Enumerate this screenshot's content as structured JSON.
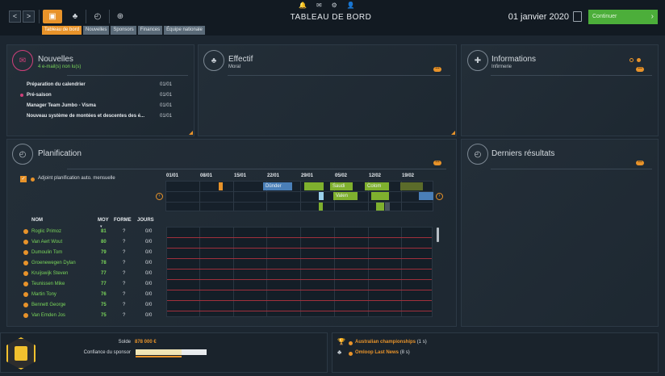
{
  "topbar": {
    "title": "TABLEAU DE BORD",
    "date": "01 janvier 2020",
    "continue_label": "Continuer",
    "nav_back": "<",
    "nav_forward": ">",
    "top_icons": [
      "bell-icon",
      "mail-icon",
      "gear-icon",
      "user-icon"
    ]
  },
  "tabs": [
    "Tableau de bord",
    "Nouvelles",
    "Sponsors",
    "Finances",
    "Équipe nationale"
  ],
  "panels": {
    "news": {
      "title": "Nouvelles",
      "subtitle": "4 e-mail(s) non lu(s)",
      "items": [
        {
          "subject": "Préparation du calendrier",
          "date": "01/01",
          "flag": false
        },
        {
          "subject": "Pré-saison",
          "date": "01/01",
          "flag": true
        },
        {
          "subject": "Manager Team Jumbo - Visma",
          "date": "01/01",
          "flag": false
        },
        {
          "subject": "Nouveau système de montées et descentes des é...",
          "date": "01/01",
          "flag": false
        }
      ]
    },
    "effectif": {
      "title": "Effectif",
      "subtitle": "Moral"
    },
    "informations": {
      "title": "Informations",
      "subtitle": "Infirmerie"
    },
    "planification": {
      "title": "Planification",
      "auto_label": "Adjoint planification auto. mensuelle",
      "dates": [
        "01/01",
        "08/01",
        "15/01",
        "22/01",
        "29/01",
        "05/02",
        "12/02",
        "19/02"
      ],
      "events": [
        {
          "label": "Dünder"
        },
        {
          "label": "Saudi"
        },
        {
          "label": "Colom"
        },
        {
          "label": "Valen"
        }
      ],
      "columns": {
        "name": "NOM",
        "moy": "MOY",
        "forme": "FORME",
        "jours": "JOURS"
      },
      "riders": [
        {
          "name": "Roglic Primoz",
          "moy": "81",
          "forme": "?",
          "jours": "0/0"
        },
        {
          "name": "Van Aert Wout",
          "moy": "80",
          "forme": "?",
          "jours": "0/0"
        },
        {
          "name": "Dumoulin Tom",
          "moy": "79",
          "forme": "?",
          "jours": "0/0"
        },
        {
          "name": "Groenewegen Dylan",
          "moy": "78",
          "forme": "?",
          "jours": "0/0"
        },
        {
          "name": "Kruijswijk Steven",
          "moy": "77",
          "forme": "?",
          "jours": "0/0"
        },
        {
          "name": "Teunissen Mike",
          "moy": "77",
          "forme": "?",
          "jours": "0/0"
        },
        {
          "name": "Martin Tony",
          "moy": "76",
          "forme": "?",
          "jours": "0/0"
        },
        {
          "name": "Bennett George",
          "moy": "75",
          "forme": "?",
          "jours": "0/0"
        },
        {
          "name": "Van Emden Jos",
          "moy": "75",
          "forme": "?",
          "jours": "0/0"
        }
      ]
    },
    "results": {
      "title": "Derniers résultats"
    }
  },
  "bottom": {
    "solde_label": "Solde",
    "solde_value": "878 000 €",
    "confidence_label": "Confiance du sponsor",
    "confidence_level": 0.65,
    "results": [
      {
        "name": "Australian championships",
        "count": "(1 s)"
      },
      {
        "name": "Omloop Last News",
        "count": "(8 s)"
      }
    ]
  },
  "colors": {
    "accent": "#e8932a",
    "success": "#4cae3a",
    "rider_green": "#7ad65a",
    "red_line": "#a0303c"
  }
}
